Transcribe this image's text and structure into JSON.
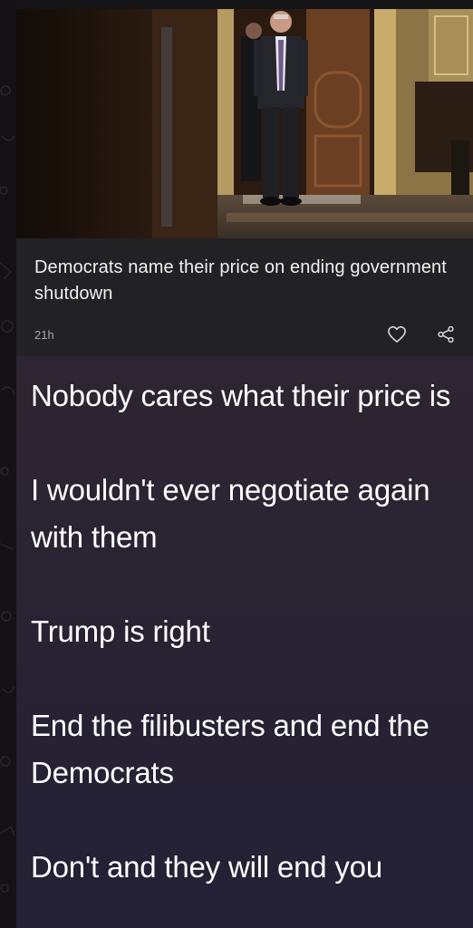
{
  "news_card": {
    "image_subject": "man-walking-through-hallway-photo",
    "title": "Democrats name their price on ending government shutdown",
    "time": "21h",
    "like_icon": "heart-icon",
    "share_icon": "share-icon"
  },
  "post": {
    "paragraphs": [
      "Nobody cares what their price is",
      "I wouldn't ever negotiate again with them",
      "Trump is right",
      "End the filibusters and end the Democrats",
      "Don't and they will end you"
    ]
  },
  "colors": {
    "card_bg": "#222124",
    "post_bg_top": "#2e2532",
    "post_bg_bottom": "#242136",
    "text_primary": "#ffffff",
    "text_secondary": "#a8a7ab"
  }
}
